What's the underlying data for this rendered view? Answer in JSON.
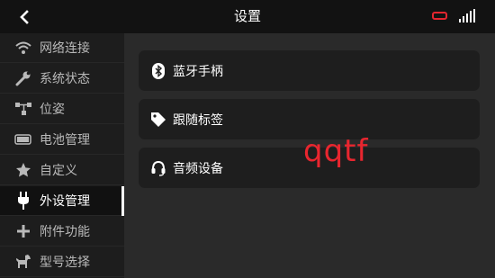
{
  "header": {
    "title": "设置",
    "back_icon": "chevron-left-icon",
    "battery_color": "#e3262f",
    "signal_icon": "signal-bars-icon"
  },
  "sidebar": {
    "items": [
      {
        "label": "网络连接",
        "icon": "wifi-icon"
      },
      {
        "label": "系统状态",
        "icon": "wrench-icon"
      },
      {
        "label": "位姿",
        "icon": "pose-icon"
      },
      {
        "label": "电池管理",
        "icon": "battery-icon"
      },
      {
        "label": "自定义",
        "icon": "star-icon"
      },
      {
        "label": "外设管理",
        "icon": "plug-icon",
        "active": true
      },
      {
        "label": "附件功能",
        "icon": "plus-icon"
      },
      {
        "label": "型号选择",
        "icon": "dog-icon"
      }
    ]
  },
  "main": {
    "cards": [
      {
        "label": "蓝牙手柄",
        "icon": "bluetooth-icon"
      },
      {
        "label": "跟随标签",
        "icon": "tag-icon"
      },
      {
        "label": "音频设备",
        "icon": "headset-icon"
      }
    ]
  },
  "overlay": {
    "text": "qqtf",
    "color": "#e8262f"
  }
}
